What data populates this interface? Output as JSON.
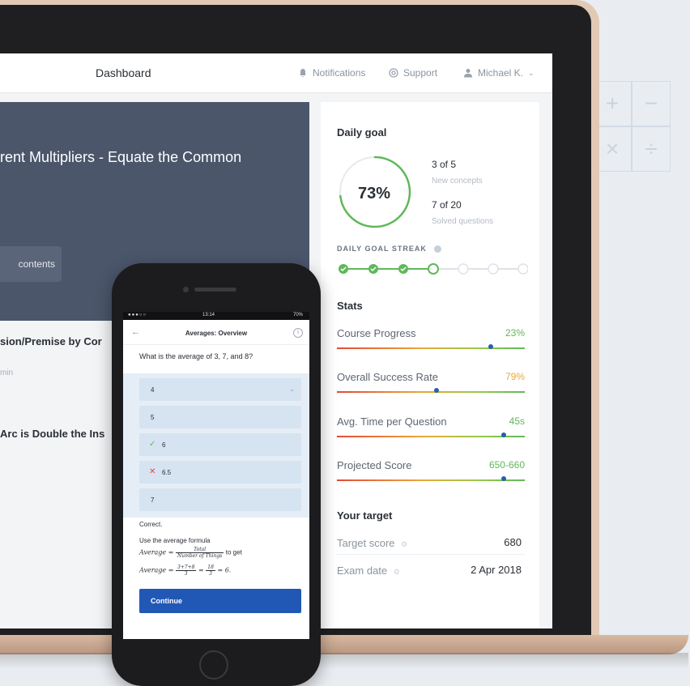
{
  "background": {
    "math_symbols": [
      "+",
      "−",
      "×",
      "÷"
    ]
  },
  "header": {
    "title": "Dashboard",
    "notifications": "Notifications",
    "support": "Support",
    "user": "Michael K."
  },
  "hero": {
    "title": "rent Multipliers - Equate the Common",
    "button": "contents"
  },
  "lessons": [
    {
      "title": "sion/Premise by Cor",
      "subtitle": "min"
    },
    {
      "title": "Arc is Double the Ins",
      "subtitle": ""
    }
  ],
  "daily_goal": {
    "heading": "Daily goal",
    "percent_text": "73%",
    "percent_value": 73,
    "concepts_count": "3 of 5",
    "concepts_label": "New concepts",
    "questions_count": "7 of 20",
    "questions_label": "Solved questions",
    "streak_label": "DAILY GOAL STREAK",
    "streak_done": 3,
    "streak_current": 1,
    "streak_total": 7
  },
  "stats": {
    "heading": "Stats",
    "items": [
      {
        "label": "Course Progress",
        "value": "23%",
        "color": "#5fb85a",
        "marker": 0.82
      },
      {
        "label": "Overall Success Rate",
        "value": "79%",
        "color": "#e8a83a",
        "marker": 0.53
      },
      {
        "label": "Avg. Time per Question",
        "value": "45s",
        "color": "#5fb85a",
        "marker": 0.89
      },
      {
        "label": "Projected Score",
        "value": "650-660",
        "color": "#5fb85a",
        "marker": 0.89
      }
    ]
  },
  "target": {
    "heading": "Your target",
    "score_label": "Target score",
    "score_value": "680",
    "date_label": "Exam date",
    "date_value": "2 Apr 2018"
  },
  "phone": {
    "status_time": "13:14",
    "status_battery": "70%",
    "nav_title": "Averages: Overview",
    "question": "What is the average of 3, 7, and 8?",
    "options": [
      {
        "text": "4",
        "state": "neutral"
      },
      {
        "text": "5",
        "state": "neutral"
      },
      {
        "text": "6",
        "state": "correct"
      },
      {
        "text": "6.5",
        "state": "wrong"
      },
      {
        "text": "7",
        "state": "neutral"
      }
    ],
    "feedback_title": "Correct.",
    "feedback_text": "Use the average formula",
    "formula_prefix": "Average =",
    "formula_num": "Total",
    "formula_den": "Number of Things",
    "formula_suffix": "to get",
    "formula2_prefix": "Average =",
    "formula2_num": "3+7+8",
    "formula2_den": "3",
    "formula2_mid": "=",
    "formula2_num2": "18",
    "formula2_den2": "3",
    "formula2_result": "= 6.",
    "continue": "Continue"
  }
}
